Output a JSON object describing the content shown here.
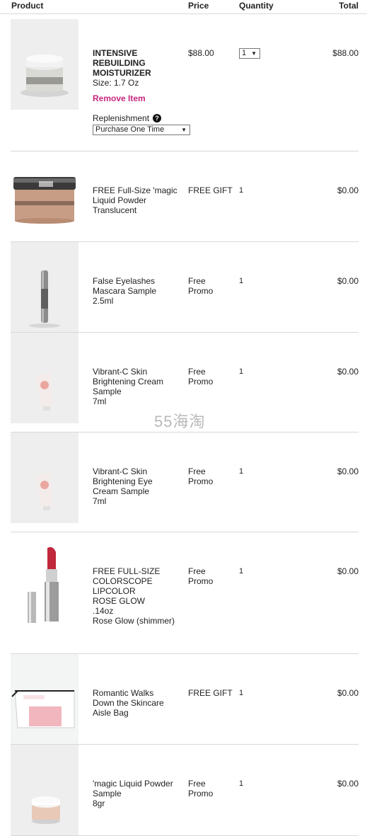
{
  "header": {
    "product": "Product",
    "price": "Price",
    "quantity": "Quantity",
    "total": "Total"
  },
  "item1": {
    "name": "INTENSIVE\nREBUILDING\nMOISTURIZER",
    "size": "Size: 1.7 Oz",
    "price": "$88.00",
    "qty": "1",
    "total": "$88.00",
    "remove": "Remove Item",
    "replenishment_label": "Replenishment",
    "replenishment_value": "Purchase One Time"
  },
  "items": [
    {
      "name": "FREE Full-Size 'magic\nLiquid Powder\nTranslucent",
      "price": "FREE GIFT",
      "qty": "1",
      "total": "$0.00"
    },
    {
      "name": "False Eyelashes\nMascara Sample\n2.5ml",
      "price": "Free\nPromo",
      "qty": "1",
      "total": "$0.00"
    },
    {
      "name": "Vibrant-C Skin\nBrightening Cream\nSample\n7ml",
      "price": "Free\nPromo",
      "qty": "1",
      "total": "$0.00"
    },
    {
      "name": "Vibrant-C Skin\nBrightening Eye\nCream Sample\n7ml",
      "price": "Free\nPromo",
      "qty": "1",
      "total": "$0.00"
    },
    {
      "name": "FREE FULL-SIZE\nCOLORSCOPE\nLIPCOLOR\nROSE GLOW\n.14oz\nRose Glow (shimmer)",
      "price": "Free\nPromo",
      "qty": "1",
      "total": "$0.00"
    },
    {
      "name": "Romantic Walks\nDown the Skincare\nAisle Bag",
      "price": "FREE GIFT",
      "qty": "1",
      "total": "$0.00"
    },
    {
      "name": "'magic Liquid Powder\nSample\n8gr",
      "price": "Free\nPromo",
      "qty": "1",
      "total": "$0.00"
    }
  ],
  "watermark": "55海淘",
  "colors": {
    "remove_link": "#c7277f",
    "divider": "#d8d8d8",
    "thumb_bg": "#eeeeee"
  }
}
